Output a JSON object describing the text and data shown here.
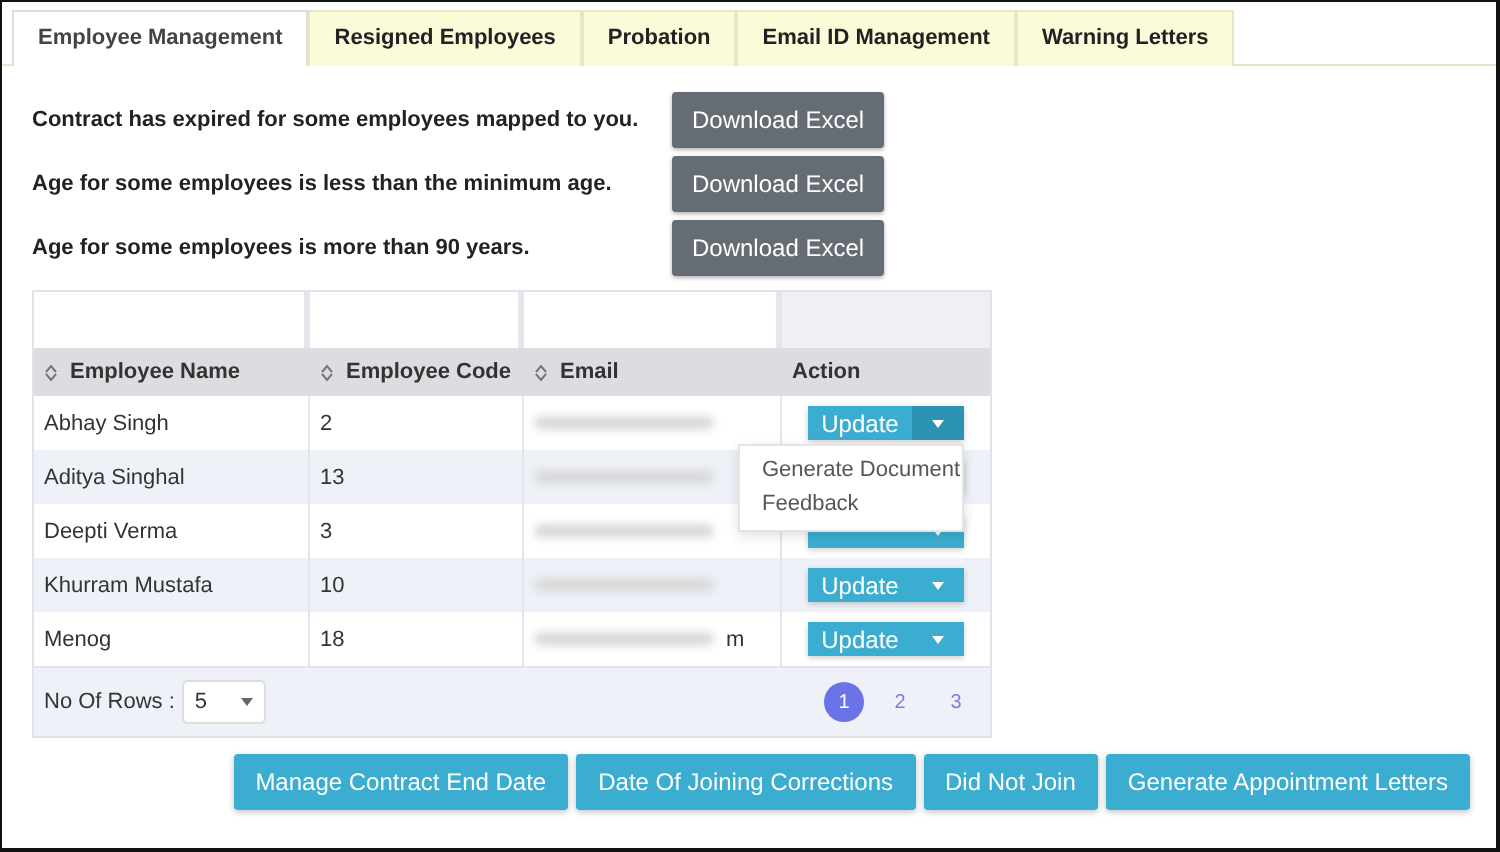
{
  "tabs": [
    {
      "label": "Employee Management",
      "selected": true
    },
    {
      "label": "Resigned Employees",
      "selected": false
    },
    {
      "label": "Probation",
      "selected": false
    },
    {
      "label": "Email ID Management",
      "selected": false
    },
    {
      "label": "Warning Letters",
      "selected": false
    }
  ],
  "alerts": [
    {
      "message": "Contract has expired for some employees mapped to you.",
      "button": "Download Excel"
    },
    {
      "message": "Age for some employees is less than the minimum age.",
      "button": "Download Excel"
    },
    {
      "message": "Age for some employees is more than 90 years.",
      "button": "Download Excel"
    }
  ],
  "table": {
    "columns": [
      {
        "label": "Employee Name",
        "sortable": true
      },
      {
        "label": "Employee Code",
        "sortable": true
      },
      {
        "label": "Email",
        "sortable": true
      },
      {
        "label": "Action",
        "sortable": false
      }
    ],
    "rows": [
      {
        "name": "Abhay Singh",
        "code": "2",
        "email_tail": "",
        "action": "Update",
        "menu_open": true
      },
      {
        "name": "Aditya Singhal",
        "code": "13",
        "email_tail": "",
        "menu_open": false
      },
      {
        "name": "Deepti Verma",
        "code": "3",
        "email_tail": "",
        "menu_open": false
      },
      {
        "name": "Khurram Mustafa",
        "code": "10",
        "email_tail": "",
        "action": "Update",
        "menu_open": false
      },
      {
        "name": "Menog",
        "code": "18",
        "email_tail": "m",
        "action": "Update",
        "menu_open": false
      }
    ],
    "menu": [
      "Generate Document",
      "Feedback"
    ],
    "rows_label": "No Of Rows :",
    "rows_value": "5",
    "pages": [
      {
        "label": "1",
        "selected": true
      },
      {
        "label": "2",
        "selected": false
      },
      {
        "label": "3",
        "selected": false
      }
    ]
  },
  "buttons": [
    "Manage Contract End Date",
    "Date Of Joining Corrections",
    "Did Not Join",
    "Generate Appointment Letters"
  ]
}
